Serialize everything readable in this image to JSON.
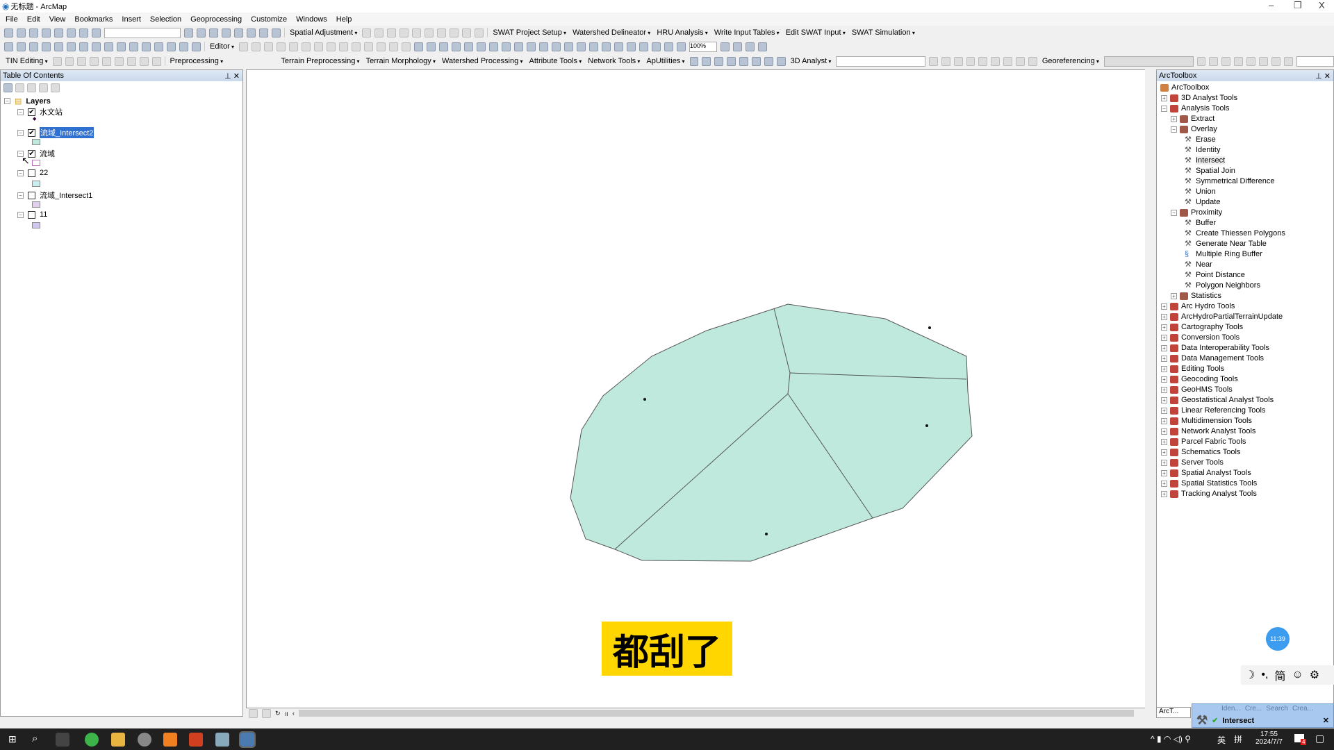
{
  "window": {
    "title": "无标题 - ArcMap",
    "minimize": "–",
    "restore": "❐",
    "close": "X"
  },
  "menu": [
    "File",
    "Edit",
    "View",
    "Bookmarks",
    "Insert",
    "Selection",
    "Geoprocessing",
    "Customize",
    "Windows",
    "Help"
  ],
  "toolbar1": {
    "spatial_adjustment": "Spatial Adjustment",
    "swat": [
      "SWAT Project Setup",
      "Watershed Delineator",
      "HRU Analysis",
      "Write Input Tables",
      "Edit SWAT Input",
      "SWAT Simulation"
    ]
  },
  "toolbar2": {
    "editor": "Editor",
    "zoom": "100%"
  },
  "toolbar3": {
    "tin_editing": "TIN Editing",
    "preprocessing": "Preprocessing",
    "arc_hydro": [
      "Terrain Preprocessing",
      "Terrain Morphology",
      "Watershed Processing",
      "Attribute Tools",
      "Network Tools",
      "ApUtilities"
    ],
    "analyst3d": "3D Analyst",
    "georef": "Georeferencing"
  },
  "toc": {
    "title": "Table Of Contents",
    "root": "Layers",
    "layers": [
      {
        "name": "水文站",
        "checked": true,
        "selected": false,
        "swatch": "point"
      },
      {
        "name": "流域_Intersect2",
        "checked": true,
        "selected": true,
        "swatch": "#bfe9dd"
      },
      {
        "name": "流域",
        "checked": true,
        "selected": false,
        "swatch": "#ffffff",
        "outline": "#c070c0"
      },
      {
        "name": "22",
        "checked": false,
        "selected": false,
        "swatch": "#c8eef0"
      },
      {
        "name": "流域_Intersect1",
        "checked": false,
        "selected": false,
        "swatch": "#e0d0ee"
      },
      {
        "name": "11",
        "checked": false,
        "selected": false,
        "swatch": "#d0c8ee"
      }
    ]
  },
  "map": {
    "fill": "#bfe9dd",
    "stroke": "#555555",
    "overlay_text": "都刮了",
    "timer": "11:39"
  },
  "toolbox": {
    "title": "ArcToolbox",
    "root": "ArcToolbox",
    "items": [
      {
        "label": "3D Analyst Tools",
        "level": 0,
        "kind": "box",
        "exp": "+"
      },
      {
        "label": "Analysis Tools",
        "level": 0,
        "kind": "box",
        "exp": "-"
      },
      {
        "label": "Extract",
        "level": 1,
        "kind": "set",
        "exp": "+"
      },
      {
        "label": "Overlay",
        "level": 1,
        "kind": "set",
        "exp": "-"
      },
      {
        "label": "Erase",
        "level": 2,
        "kind": "tool"
      },
      {
        "label": "Identity",
        "level": 2,
        "kind": "tool"
      },
      {
        "label": "Intersect",
        "level": 2,
        "kind": "tool",
        "highlight": true
      },
      {
        "label": "Spatial Join",
        "level": 2,
        "kind": "tool"
      },
      {
        "label": "Symmetrical Difference",
        "level": 2,
        "kind": "tool"
      },
      {
        "label": "Union",
        "level": 2,
        "kind": "tool"
      },
      {
        "label": "Update",
        "level": 2,
        "kind": "tool"
      },
      {
        "label": "Proximity",
        "level": 1,
        "kind": "set",
        "exp": "-"
      },
      {
        "label": "Buffer",
        "level": 2,
        "kind": "tool"
      },
      {
        "label": "Create Thiessen Polygons",
        "level": 2,
        "kind": "tool"
      },
      {
        "label": "Generate Near Table",
        "level": 2,
        "kind": "tool"
      },
      {
        "label": "Multiple Ring Buffer",
        "level": 2,
        "kind": "script"
      },
      {
        "label": "Near",
        "level": 2,
        "kind": "tool"
      },
      {
        "label": "Point Distance",
        "level": 2,
        "kind": "tool"
      },
      {
        "label": "Polygon Neighbors",
        "level": 2,
        "kind": "tool"
      },
      {
        "label": "Statistics",
        "level": 1,
        "kind": "set",
        "exp": "+"
      },
      {
        "label": "Arc Hydro Tools",
        "level": 0,
        "kind": "box",
        "exp": "+"
      },
      {
        "label": "ArcHydroPartialTerrainUpdate",
        "level": 0,
        "kind": "box",
        "exp": "+"
      },
      {
        "label": "Cartography Tools",
        "level": 0,
        "kind": "box",
        "exp": "+"
      },
      {
        "label": "Conversion Tools",
        "level": 0,
        "kind": "box",
        "exp": "+"
      },
      {
        "label": "Data Interoperability Tools",
        "level": 0,
        "kind": "box",
        "exp": "+"
      },
      {
        "label": "Data Management Tools",
        "level": 0,
        "kind": "box",
        "exp": "+"
      },
      {
        "label": "Editing Tools",
        "level": 0,
        "kind": "box",
        "exp": "+"
      },
      {
        "label": "Geocoding Tools",
        "level": 0,
        "kind": "box",
        "exp": "+"
      },
      {
        "label": "GeoHMS Tools",
        "level": 0,
        "kind": "box",
        "exp": "+"
      },
      {
        "label": "Geostatistical Analyst Tools",
        "level": 0,
        "kind": "box",
        "exp": "+"
      },
      {
        "label": "Linear Referencing Tools",
        "level": 0,
        "kind": "box",
        "exp": "+"
      },
      {
        "label": "Multidimension Tools",
        "level": 0,
        "kind": "box",
        "exp": "+"
      },
      {
        "label": "Network Analyst Tools",
        "level": 0,
        "kind": "box",
        "exp": "+"
      },
      {
        "label": "Parcel Fabric Tools",
        "level": 0,
        "kind": "box",
        "exp": "+"
      },
      {
        "label": "Schematics Tools",
        "level": 0,
        "kind": "box",
        "exp": "+"
      },
      {
        "label": "Server Tools",
        "level": 0,
        "kind": "box",
        "exp": "+"
      },
      {
        "label": "Spatial Analyst Tools",
        "level": 0,
        "kind": "box",
        "exp": "+"
      },
      {
        "label": "Spatial Statistics Tools",
        "level": 0,
        "kind": "box",
        "exp": "+"
      },
      {
        "label": "Tracking Analyst Tools",
        "level": 0,
        "kind": "box",
        "exp": "+"
      }
    ],
    "tab": "ArcT...",
    "bg_tabs": [
      "Iden...",
      "Cre...",
      "Search",
      "Crea..."
    ]
  },
  "ime": {
    "items": [
      "☽",
      "•,",
      "简",
      "☺",
      "⚙"
    ]
  },
  "popup": {
    "label": "Intersect"
  },
  "taskbar": {
    "time": "17:55",
    "date": "2024/7/7",
    "lang": "英",
    "badge": "4"
  }
}
